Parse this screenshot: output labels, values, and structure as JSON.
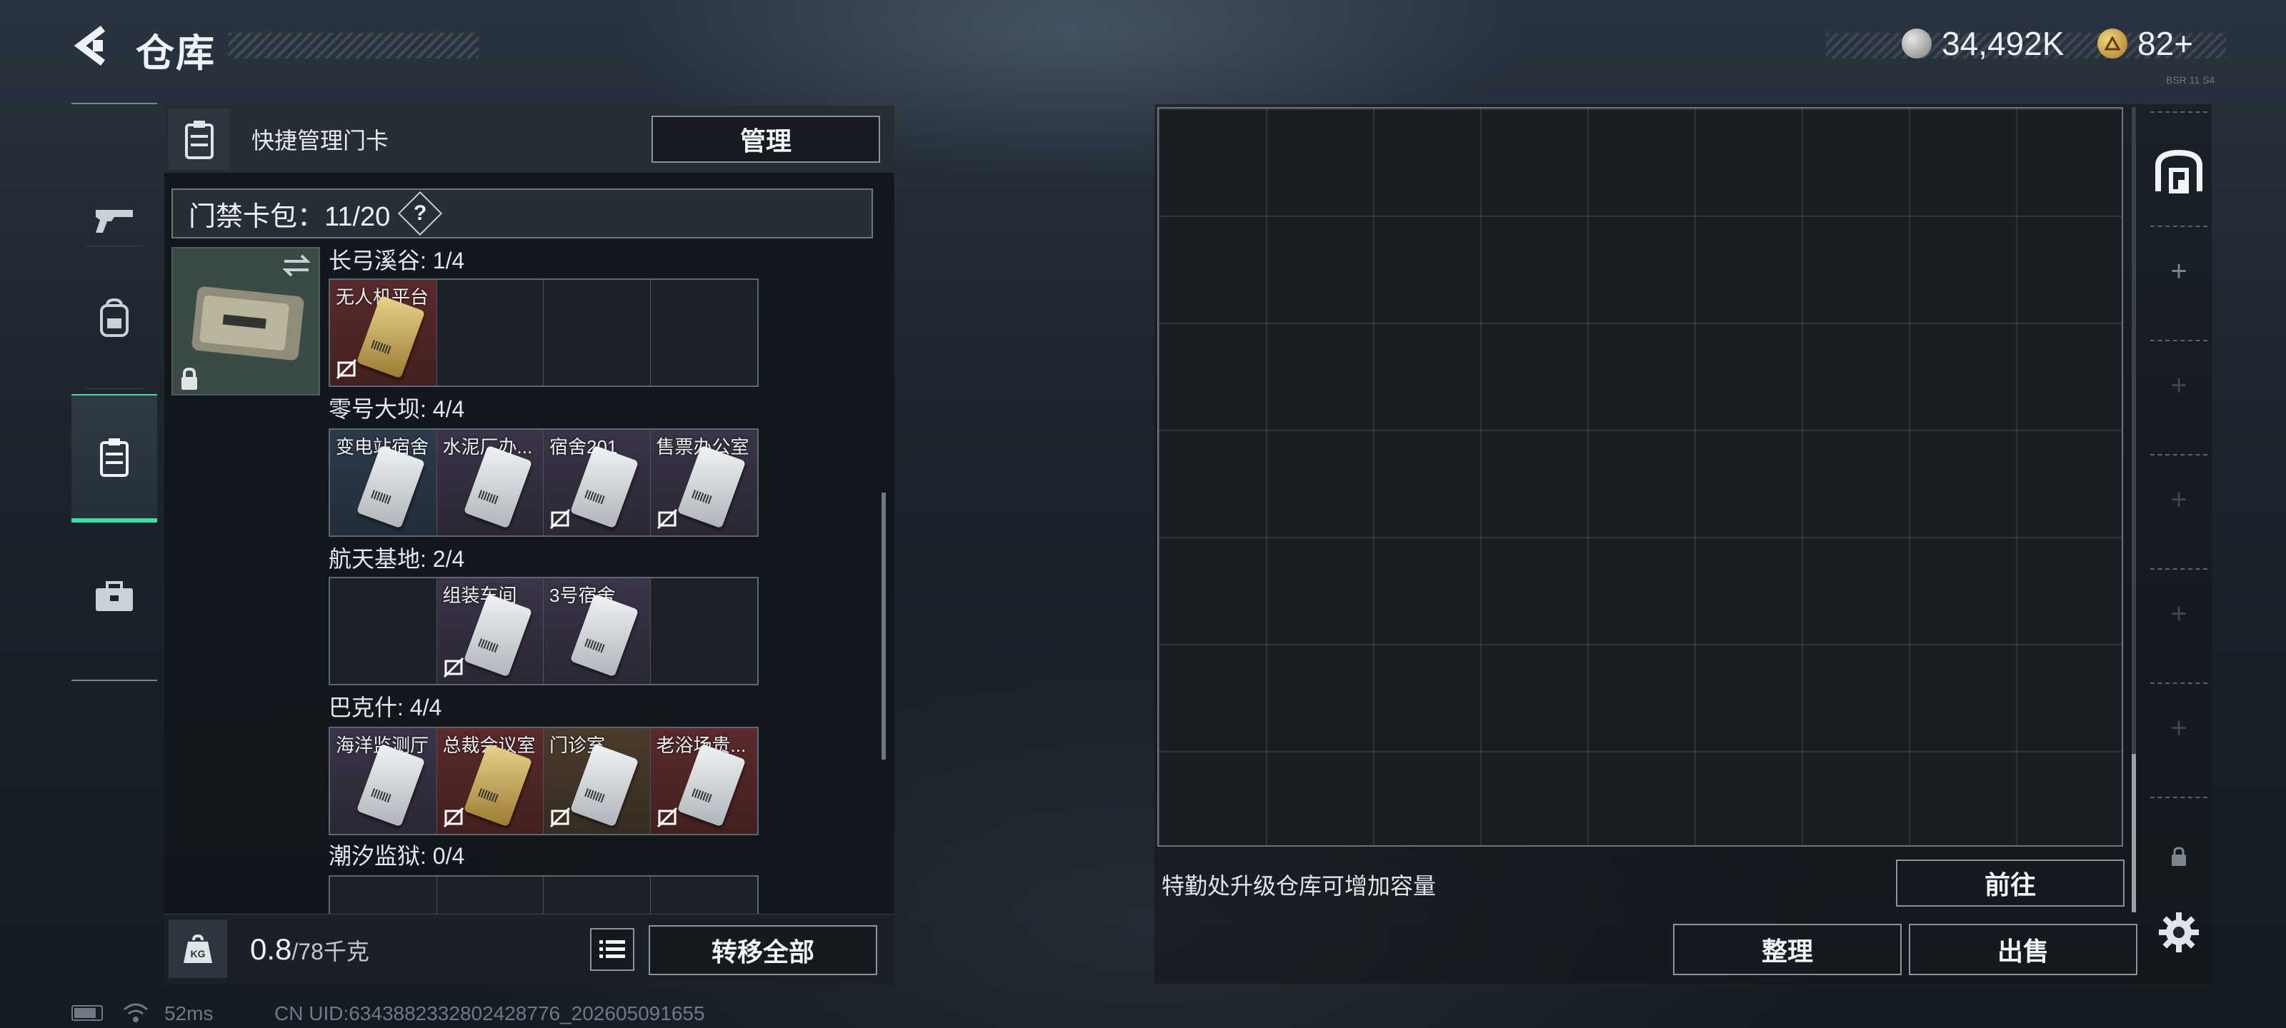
{
  "header": {
    "title": "仓库",
    "currencies": [
      {
        "icon": "silver-coin-icon",
        "value": "34,492K"
      },
      {
        "icon": "gold-coin-icon",
        "value": "82+"
      }
    ],
    "tiny_code": "BSR 11 S4"
  },
  "nav": [
    {
      "name": "weapons",
      "icon": "gun-icon",
      "active": false
    },
    {
      "name": "backpack",
      "icon": "backpack-icon",
      "active": false
    },
    {
      "name": "keycards",
      "icon": "keycard-holder-icon",
      "active": true
    },
    {
      "name": "toolbox",
      "icon": "toolbox-icon",
      "active": false
    }
  ],
  "left_panel": {
    "title": "快捷管理门卡",
    "manage_label": "管理",
    "keycard_pack_label": "门禁卡包：11/20",
    "help_label": "?",
    "groups": [
      {
        "title": "长弓溪谷: 1/4",
        "cells": [
          {
            "label": "无人机平台",
            "style": "red",
            "card": "gold",
            "nolink": true
          },
          {
            "label": "",
            "style": "empty"
          },
          {
            "label": "",
            "style": "empty"
          },
          {
            "label": "",
            "style": "empty"
          }
        ]
      },
      {
        "title": "零号大坝: 4/4",
        "cells": [
          {
            "label": "变电站宿舍",
            "style": "blue",
            "card": "white",
            "nolink": false
          },
          {
            "label": "水泥厂办...",
            "style": "purple",
            "card": "white",
            "nolink": false
          },
          {
            "label": "宿舍201",
            "style": "purple",
            "card": "white",
            "nolink": true
          },
          {
            "label": "售票办公室",
            "style": "purple",
            "card": "white",
            "nolink": true
          }
        ]
      },
      {
        "title": "航天基地: 2/4",
        "cells": [
          {
            "label": "",
            "style": "empty"
          },
          {
            "label": "组装车间",
            "style": "purple",
            "card": "white",
            "nolink": true
          },
          {
            "label": "3号宿舍",
            "style": "purple",
            "card": "white",
            "nolink": false
          },
          {
            "label": "",
            "style": "empty"
          }
        ]
      },
      {
        "title": "巴克什: 4/4",
        "cells": [
          {
            "label": "海洋监测厅",
            "style": "purple",
            "card": "white",
            "nolink": false
          },
          {
            "label": "总裁会议室",
            "style": "red",
            "card": "gold",
            "nolink": true
          },
          {
            "label": "门诊室",
            "style": "brown",
            "card": "white",
            "nolink": true
          },
          {
            "label": "老浴场贵...",
            "style": "red",
            "card": "white",
            "nolink": true
          }
        ]
      },
      {
        "title": "潮汐监狱: 0/4",
        "cells": []
      }
    ],
    "weight_value": "0.8",
    "weight_capacity": "/78千克",
    "kg_badge": "KG",
    "transfer_all_label": "转移全部"
  },
  "storage": {
    "upgrade_hint": "特勤处升级仓库可增加容量",
    "goto_label": "前往",
    "sort_label": "整理",
    "sell_label": "出售"
  },
  "status_bar": {
    "ping": "52ms",
    "uid": "CN UID:6343882332802428776_202605091655"
  }
}
